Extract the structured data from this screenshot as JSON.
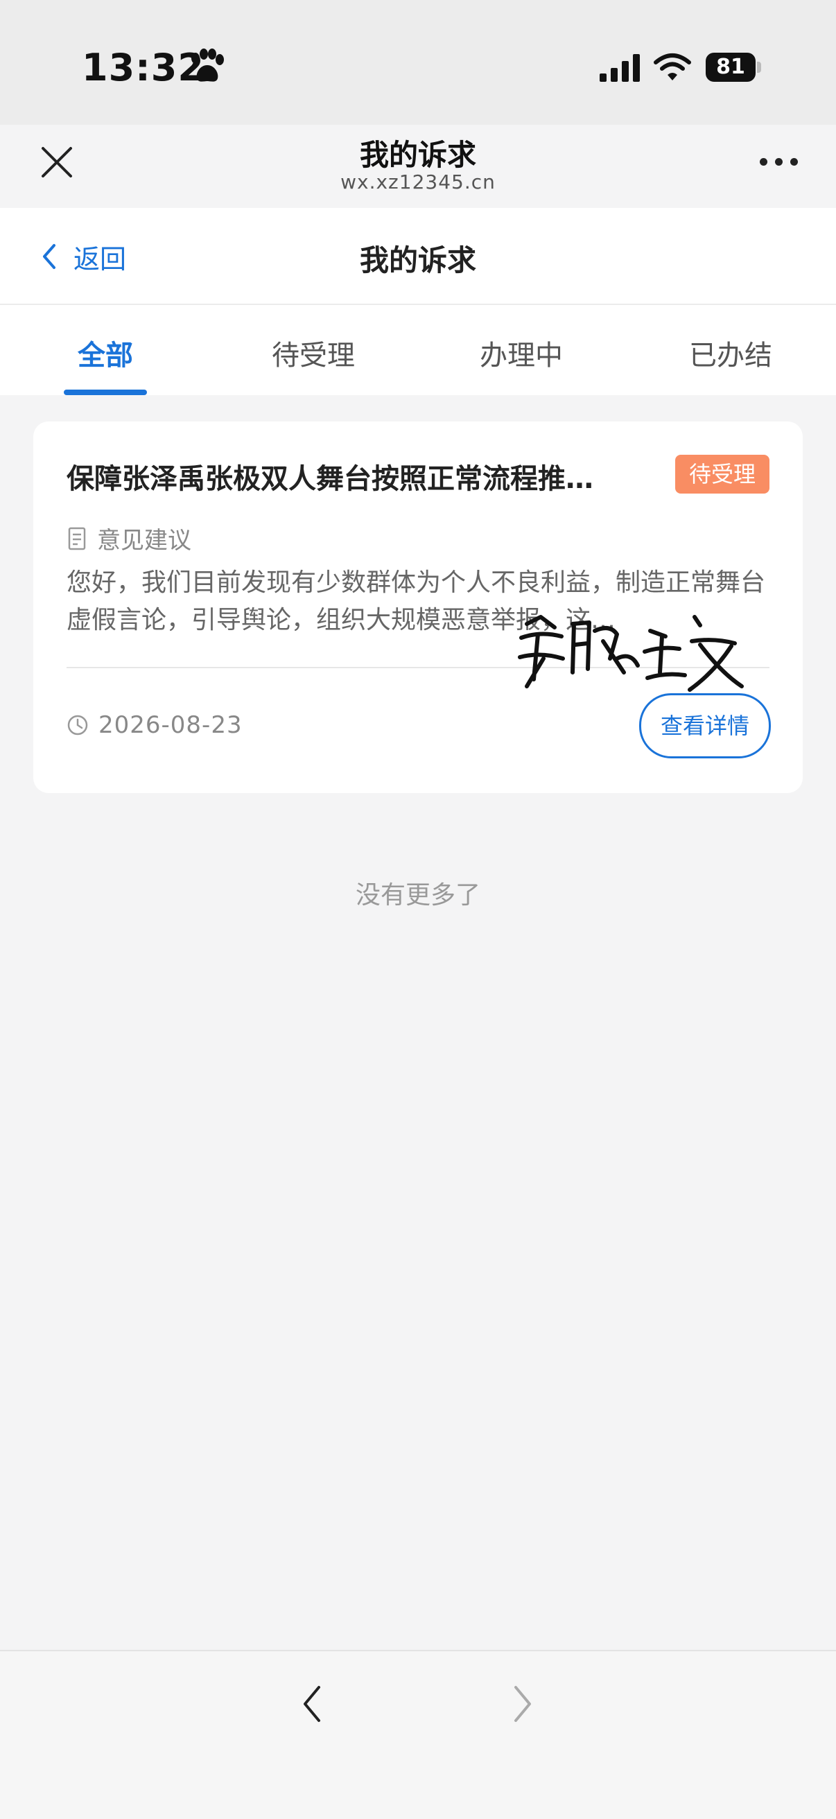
{
  "status_bar": {
    "time": "13:32",
    "battery": "81"
  },
  "webview": {
    "title": "我的诉求",
    "url": "wx.xz12345.cn"
  },
  "page_header": {
    "back_label": "返回",
    "title": "我的诉求"
  },
  "tabs": [
    {
      "label": "全部",
      "active": true
    },
    {
      "label": "待受理",
      "active": false
    },
    {
      "label": "办理中",
      "active": false
    },
    {
      "label": "已办结",
      "active": false
    }
  ],
  "cards": [
    {
      "title": "保障张泽禹张极双人舞台按照正常流程推…",
      "status": "待受理",
      "category": "意见建议",
      "description": "您好，我们目前发现有少数群体为个人不良利益，制造正常舞台虚假言论，引导舆论，组织大规模恶意举报，这…",
      "date": "2026-08-23",
      "detail_button": "查看详情"
    }
  ],
  "signature_text": "常瞎主义",
  "no_more": "没有更多了",
  "colors": {
    "accent": "#1a73d9",
    "badge": "#f98d63",
    "background": "#f4f4f5"
  }
}
